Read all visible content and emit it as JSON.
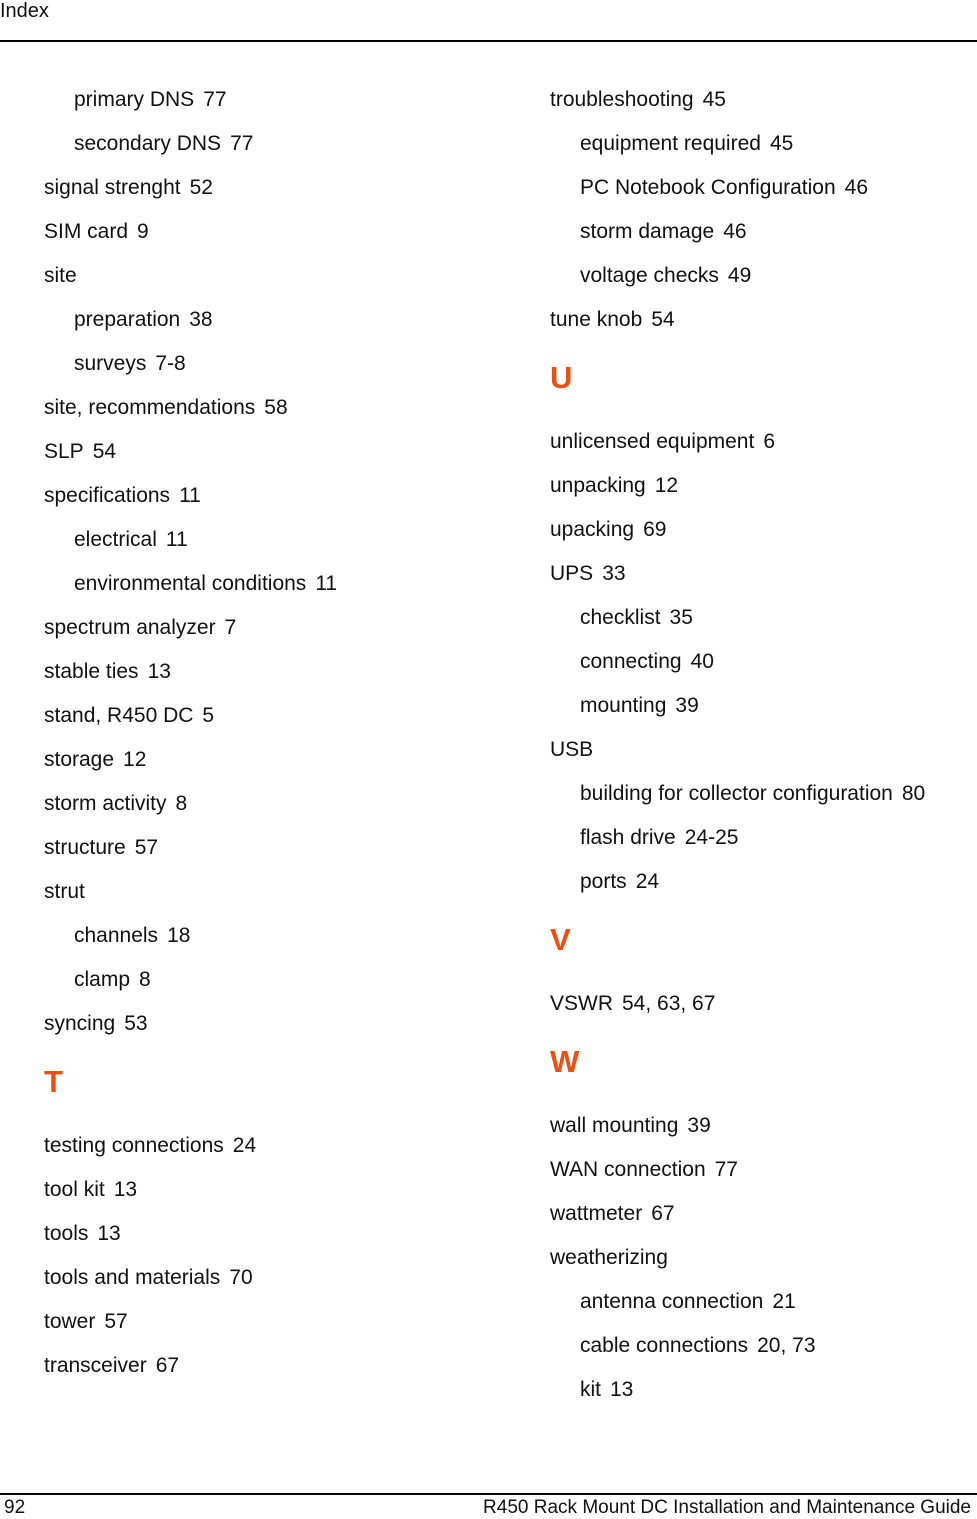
{
  "header": {
    "title": "Index"
  },
  "footer": {
    "page_number": "92",
    "guide_title": "R450 Rack Mount DC Installation and Maintenance Guide"
  },
  "accent_color": "#f04e0f",
  "left_column": [
    {
      "type": "sub",
      "term": "primary DNS",
      "pages": "77"
    },
    {
      "type": "sub",
      "term": "secondary DNS",
      "pages": "77"
    },
    {
      "type": "main",
      "term": "signal strenght",
      "pages": "52"
    },
    {
      "type": "main",
      "term": "SIM card",
      "pages": "9"
    },
    {
      "type": "main",
      "term": "site",
      "pages": ""
    },
    {
      "type": "sub",
      "term": "preparation",
      "pages": "38"
    },
    {
      "type": "sub",
      "term": "surveys",
      "pages": "7-8"
    },
    {
      "type": "main",
      "term": "site, recommendations",
      "pages": "58"
    },
    {
      "type": "main",
      "term": "SLP",
      "pages": "54"
    },
    {
      "type": "main",
      "term": "specifications",
      "pages": "11"
    },
    {
      "type": "sub",
      "term": "electrical",
      "pages": "11"
    },
    {
      "type": "sub",
      "term": "environmental conditions",
      "pages": "11"
    },
    {
      "type": "main",
      "term": "spectrum analyzer",
      "pages": "7"
    },
    {
      "type": "main",
      "term": "stable ties",
      "pages": "13"
    },
    {
      "type": "main",
      "term": "stand, R450 DC",
      "pages": "5"
    },
    {
      "type": "main",
      "term": "storage",
      "pages": "12"
    },
    {
      "type": "main",
      "term": "storm activity",
      "pages": "8"
    },
    {
      "type": "main",
      "term": "structure",
      "pages": "57"
    },
    {
      "type": "main",
      "term": "strut",
      "pages": ""
    },
    {
      "type": "sub",
      "term": "channels",
      "pages": "18"
    },
    {
      "type": "sub",
      "term": "clamp",
      "pages": "8"
    },
    {
      "type": "main",
      "term": "syncing",
      "pages": "53"
    },
    {
      "type": "letter",
      "term": "T",
      "pages": ""
    },
    {
      "type": "main",
      "term": "testing connections",
      "pages": "24"
    },
    {
      "type": "main",
      "term": "tool kit",
      "pages": "13"
    },
    {
      "type": "main",
      "term": "tools",
      "pages": "13"
    },
    {
      "type": "main",
      "term": "tools and materials",
      "pages": "70"
    },
    {
      "type": "main",
      "term": "tower",
      "pages": "57"
    },
    {
      "type": "main",
      "term": "transceiver",
      "pages": "67"
    }
  ],
  "right_column": [
    {
      "type": "main",
      "term": "troubleshooting",
      "pages": "45"
    },
    {
      "type": "sub",
      "term": "equipment required",
      "pages": "45"
    },
    {
      "type": "sub",
      "term": "PC Notebook Configuration",
      "pages": "46"
    },
    {
      "type": "sub",
      "term": "storm damage",
      "pages": "46"
    },
    {
      "type": "sub",
      "term": "voltage checks",
      "pages": "49"
    },
    {
      "type": "main",
      "term": "tune knob",
      "pages": "54"
    },
    {
      "type": "letter",
      "term": "U",
      "pages": ""
    },
    {
      "type": "main",
      "term": "unlicensed equipment",
      "pages": "6"
    },
    {
      "type": "main",
      "term": "unpacking",
      "pages": "12"
    },
    {
      "type": "main",
      "term": "upacking",
      "pages": "69"
    },
    {
      "type": "main",
      "term": "UPS",
      "pages": "33"
    },
    {
      "type": "sub",
      "term": "checklist",
      "pages": "35"
    },
    {
      "type": "sub",
      "term": "connecting",
      "pages": "40"
    },
    {
      "type": "sub",
      "term": "mounting",
      "pages": "39"
    },
    {
      "type": "main",
      "term": "USB",
      "pages": ""
    },
    {
      "type": "sub",
      "term": "building for collector configuration",
      "pages": "80"
    },
    {
      "type": "sub",
      "term": "flash drive",
      "pages": "24-25"
    },
    {
      "type": "sub",
      "term": "ports",
      "pages": "24"
    },
    {
      "type": "letter",
      "term": "V",
      "pages": ""
    },
    {
      "type": "main",
      "term": "VSWR",
      "pages": "54, 63, 67"
    },
    {
      "type": "letter",
      "term": "W",
      "pages": ""
    },
    {
      "type": "main",
      "term": "wall mounting",
      "pages": "39"
    },
    {
      "type": "main",
      "term": "WAN connection",
      "pages": "77"
    },
    {
      "type": "main",
      "term": "wattmeter",
      "pages": "67"
    },
    {
      "type": "main",
      "term": "weatherizing",
      "pages": ""
    },
    {
      "type": "sub",
      "term": "antenna connection",
      "pages": "21"
    },
    {
      "type": "sub",
      "term": "cable connections",
      "pages": "20, 73"
    },
    {
      "type": "sub",
      "term": "kit",
      "pages": "13"
    }
  ]
}
